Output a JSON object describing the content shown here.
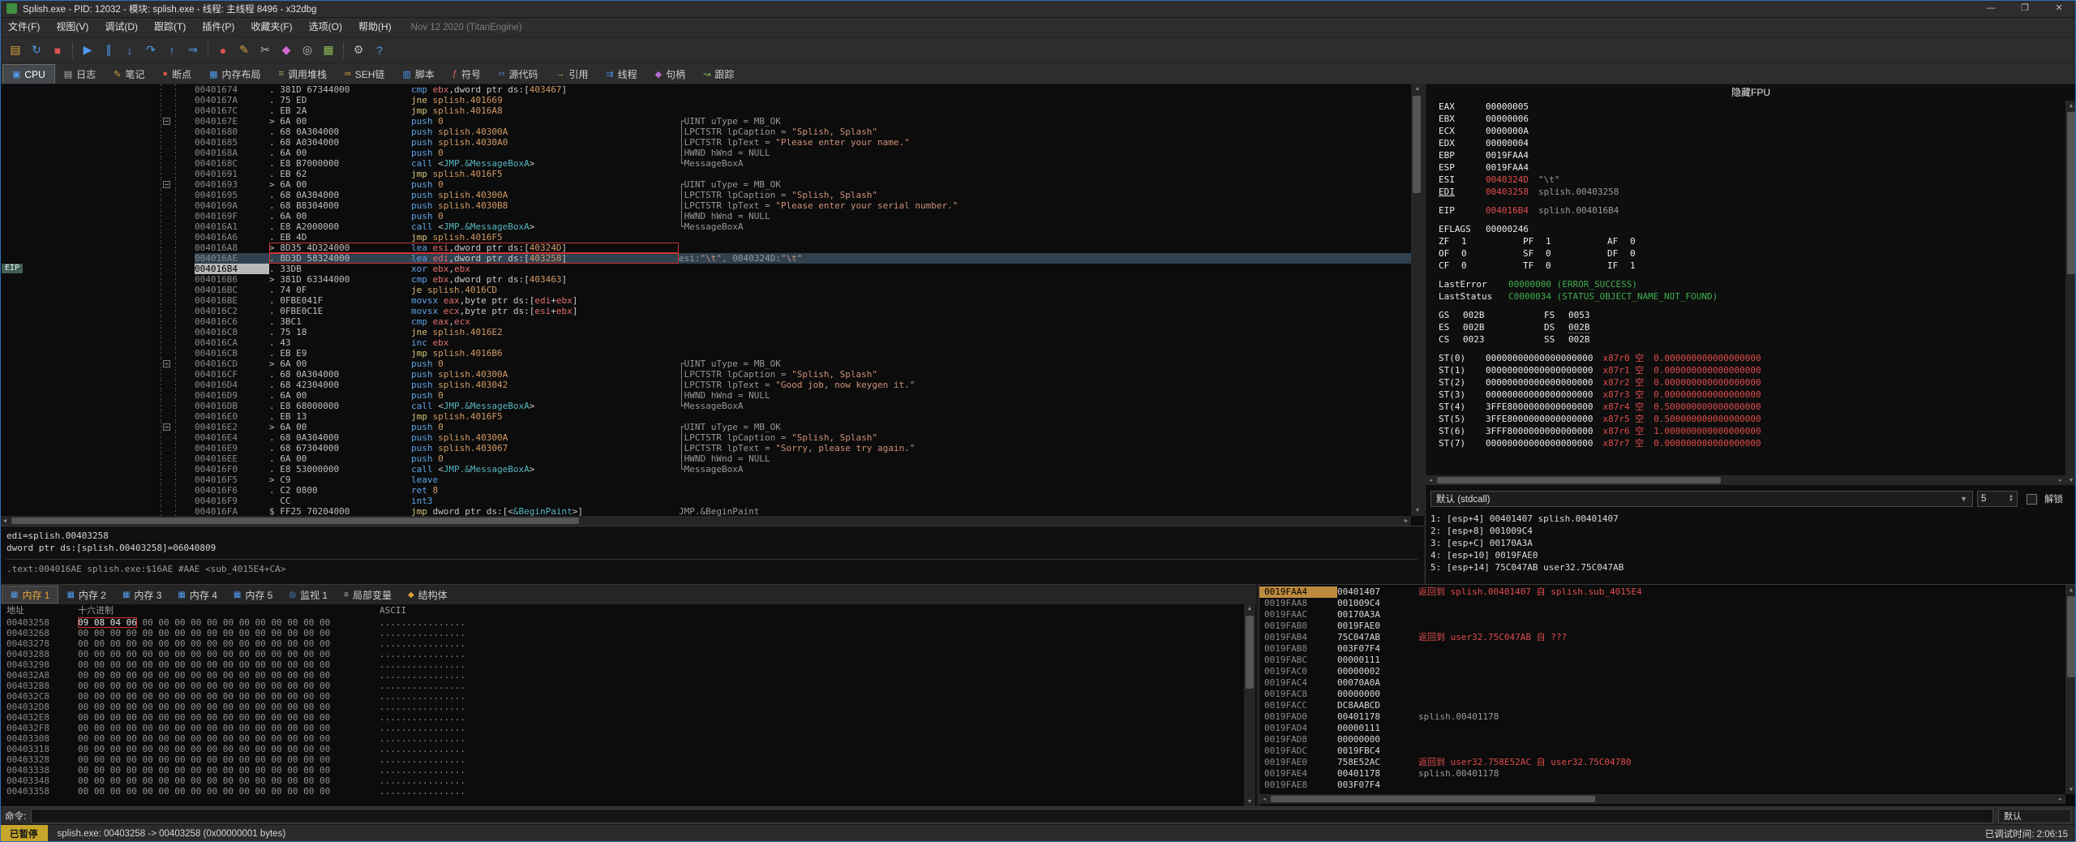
{
  "window": {
    "title": "Splish.exe - PID: 12032 - 模块: splish.exe - 线程: 主线程 8496 - x32dbg",
    "controls": {
      "minimize": "—",
      "maximize": "❐",
      "close": "✕"
    }
  },
  "menu": {
    "items": [
      "文件(F)",
      "视图(V)",
      "调试(D)",
      "跟踪(T)",
      "插件(P)",
      "收藏夹(F)",
      "选项(O)",
      "帮助(H)"
    ],
    "build_info": "Nov 12 2020 (TitanEngine)"
  },
  "toolbar": {
    "icons": [
      {
        "name": "open-file-icon",
        "glyph": "▤",
        "color": "#d9a33c"
      },
      {
        "name": "restart-icon",
        "glyph": "↻",
        "color": "#4f9cf0"
      },
      {
        "name": "stop-icon",
        "glyph": "■",
        "color": "#d9534f"
      },
      {
        "sep": true
      },
      {
        "name": "run-icon",
        "glyph": "▶",
        "color": "#4f9cf0"
      },
      {
        "name": "pause-icon",
        "glyph": "∥",
        "color": "#4f9cf0"
      },
      {
        "name": "step-into-icon",
        "glyph": "↓",
        "color": "#4f9cf0"
      },
      {
        "name": "step-over-icon",
        "glyph": "↷",
        "color": "#4f9cf0"
      },
      {
        "name": "step-out-icon",
        "glyph": "↑",
        "color": "#4f9cf0"
      },
      {
        "name": "run-to-cursor-icon",
        "glyph": "⇒",
        "color": "#4f9cf0"
      },
      {
        "sep": true
      },
      {
        "name": "breakpoint-icon",
        "glyph": "●",
        "color": "#d9534f"
      },
      {
        "name": "patch-icon",
        "glyph": "✎",
        "color": "#d9a33c"
      },
      {
        "name": "scissors-icon",
        "glyph": "✂",
        "color": "#b8b8b8"
      },
      {
        "name": "favourites-icon",
        "glyph": "◆",
        "color": "#d06ad0"
      },
      {
        "name": "search-icon",
        "glyph": "◎",
        "color": "#b8b8b8"
      },
      {
        "name": "calculator-icon",
        "glyph": "▦",
        "color": "#8fbc5a"
      },
      {
        "sep": true
      },
      {
        "name": "settings-icon",
        "glyph": "⚙",
        "color": "#b8b8b8"
      },
      {
        "name": "help-icon",
        "glyph": "?",
        "color": "#4f9cf0"
      }
    ]
  },
  "main_tabs": [
    {
      "id": "cpu",
      "label": "CPU",
      "icon": "cpu-icon",
      "glyph": "▣",
      "color": "#4f9cf0",
      "active": true
    },
    {
      "id": "log",
      "label": "日志",
      "icon": "log-icon",
      "glyph": "▤",
      "color": "#b8b8b8"
    },
    {
      "id": "notes",
      "label": "笔记",
      "icon": "notes-icon",
      "glyph": "✎",
      "color": "#d9a33c"
    },
    {
      "id": "breakpoints",
      "label": "断点",
      "icon": "breakpoint-icon",
      "glyph": "●",
      "color": "#d9534f"
    },
    {
      "id": "memory-map",
      "label": "内存布局",
      "icon": "memory-map-icon",
      "glyph": "▦",
      "color": "#4f9cf0"
    },
    {
      "id": "call-stack",
      "label": "调用堆栈",
      "icon": "call-stack-icon",
      "glyph": "≡",
      "color": "#8fbc5a"
    },
    {
      "id": "seh",
      "label": "SEH链",
      "icon": "seh-chain-icon",
      "glyph": "∞",
      "color": "#d9a33c"
    },
    {
      "id": "script",
      "label": "脚本",
      "icon": "script-icon",
      "glyph": "▥",
      "color": "#4f9cf0"
    },
    {
      "id": "symbols",
      "label": "符号",
      "icon": "symbols-icon",
      "glyph": "ƒ",
      "color": "#e06c6c"
    },
    {
      "id": "source",
      "label": "源代码",
      "icon": "source-code-icon",
      "glyph": "‹›",
      "color": "#4f9cf0"
    },
    {
      "id": "references",
      "label": "引用",
      "icon": "references-icon",
      "glyph": "→",
      "color": "#d9a33c"
    },
    {
      "id": "threads",
      "label": "线程",
      "icon": "threads-icon",
      "glyph": "⇉",
      "color": "#4f9cf0"
    },
    {
      "id": "handles",
      "label": "句柄",
      "icon": "handles-icon",
      "glyph": "◆",
      "color": "#b06ad0"
    },
    {
      "id": "trace",
      "label": "跟踪",
      "icon": "trace-icon",
      "glyph": "↝",
      "color": "#8fbc5a"
    }
  ],
  "disasm": {
    "eip_badge": "EIP",
    "rows": [
      {
        "a": "00401674",
        "b": ". 381D 67344000",
        "i": "cmp ebx,dword ptr ds:[403467]",
        "c": ""
      },
      {
        "a": "0040167A",
        "b": ". 75 ED",
        "i": "jne splish.401669",
        "c": ""
      },
      {
        "a": "0040167C",
        "b": ". EB 2A",
        "i": "jmp splish.4016A8",
        "c": ""
      },
      {
        "a": "0040167E",
        "b": "> 6A 00",
        "i": "push 0",
        "c": "┌UINT uType = MB_OK",
        "g": "box"
      },
      {
        "a": "00401680",
        "b": ". 68 0A304000",
        "i": "push splish.40300A",
        "c": "│LPCTSTR lpCaption = \"Splish, Splash\""
      },
      {
        "a": "00401685",
        "b": ". 68 A0304000",
        "i": "push splish.4030A0",
        "c": "│LPCTSTR lpText = \"Please enter your name.\""
      },
      {
        "a": "0040168A",
        "b": ". 6A 00",
        "i": "push 0",
        "c": "│HWND hWnd = NULL"
      },
      {
        "a": "0040168C",
        "b": ". E8 B7000000",
        "i": "call <JMP.&MessageBoxA>",
        "c": "└MessageBoxA"
      },
      {
        "a": "00401691",
        "b": ". EB 62",
        "i": "jmp splish.4016F5",
        "c": ""
      },
      {
        "a": "00401693",
        "b": "> 6A 00",
        "i": "push 0",
        "c": "┌UINT uType = MB_OK",
        "g": "box"
      },
      {
        "a": "00401695",
        "b": ". 68 0A304000",
        "i": "push splish.40300A",
        "c": "│LPCTSTR lpCaption = \"Splish, Splash\""
      },
      {
        "a": "0040169A",
        "b": ". 68 B8304000",
        "i": "push splish.4030B8",
        "c": "│LPCTSTR lpText = \"Please enter your serial number.\""
      },
      {
        "a": "0040169F",
        "b": ". 6A 00",
        "i": "push 0",
        "c": "│HWND hWnd = NULL"
      },
      {
        "a": "004016A1",
        "b": ". E8 A2000000",
        "i": "call <JMP.&MessageBoxA>",
        "c": "└MessageBoxA"
      },
      {
        "a": "004016A6",
        "b": ". EB 4D",
        "i": "jmp splish.4016F5",
        "c": ""
      },
      {
        "a": "004016A8",
        "b": "> 8D35 4D324000",
        "i": "lea esi,dword ptr ds:[40324D]",
        "c": "",
        "f": "bp"
      },
      {
        "a": "004016AE",
        "b": ". 8D3D 58324000",
        "i": "lea edi,dword ptr ds:[403258]",
        "c": "esi:\"\\t\", 0040324D:\"\\t\"",
        "f": "sel bp"
      },
      {
        "a": "004016B4",
        "b": ". 33DB",
        "i": "xor ebx,ebx",
        "c": "",
        "f": "eip",
        "g": "eip"
      },
      {
        "a": "004016B6",
        "b": "> 381D 63344000",
        "i": "cmp ebx,dword ptr ds:[403463]",
        "c": ""
      },
      {
        "a": "004016BC",
        "b": ". 74 0F",
        "i": "je splish.4016CD",
        "c": ""
      },
      {
        "a": "004016BE",
        "b": ". 0FBE041F",
        "i": "movsx eax,byte ptr ds:[edi+ebx]",
        "c": ""
      },
      {
        "a": "004016C2",
        "b": ". 0FBE0C1E",
        "i": "movsx ecx,byte ptr ds:[esi+ebx]",
        "c": ""
      },
      {
        "a": "004016C6",
        "b": ". 3BC1",
        "i": "cmp eax,ecx",
        "c": ""
      },
      {
        "a": "004016C8",
        "b": ". 75 18",
        "i": "jne splish.4016E2",
        "c": ""
      },
      {
        "a": "004016CA",
        "b": ". 43",
        "i": "inc ebx",
        "c": ""
      },
      {
        "a": "004016CB",
        "b": ". EB E9",
        "i": "jmp splish.4016B6",
        "c": ""
      },
      {
        "a": "004016CD",
        "b": "> 6A 00",
        "i": "push 0",
        "c": "┌UINT uType = MB_OK",
        "g": "box"
      },
      {
        "a": "004016CF",
        "b": ". 68 0A304000",
        "i": "push splish.40300A",
        "c": "│LPCTSTR lpCaption = \"Splish, Splash\""
      },
      {
        "a": "004016D4",
        "b": ". 68 42304000",
        "i": "push splish.403042",
        "c": "│LPCTSTR lpText = \"Good job, now keygen it.\""
      },
      {
        "a": "004016D9",
        "b": ". 6A 00",
        "i": "push 0",
        "c": "│HWND hWnd = NULL"
      },
      {
        "a": "004016DB",
        "b": ". E8 68000000",
        "i": "call <JMP.&MessageBoxA>",
        "c": "└MessageBoxA"
      },
      {
        "a": "004016E0",
        "b": ". EB 13",
        "i": "jmp splish.4016F5",
        "c": ""
      },
      {
        "a": "004016E2",
        "b": "> 6A 00",
        "i": "push 0",
        "c": "┌UINT uType = MB_OK",
        "g": "box"
      },
      {
        "a": "004016E4",
        "b": ". 68 0A304000",
        "i": "push splish.40300A",
        "c": "│LPCTSTR lpCaption = \"Splish, Splash\""
      },
      {
        "a": "004016E9",
        "b": ". 68 67304000",
        "i": "push splish.403067",
        "c": "│LPCTSTR lpText = \"Sorry, please try again.\""
      },
      {
        "a": "004016EE",
        "b": ". 6A 00",
        "i": "push 0",
        "c": "│HWND hWnd = NULL"
      },
      {
        "a": "004016F0",
        "b": ". E8 53000000",
        "i": "call <JMP.&MessageBoxA>",
        "c": "└MessageBoxA"
      },
      {
        "a": "004016F5",
        "b": "> C9",
        "i": "leave",
        "c": ""
      },
      {
        "a": "004016F6",
        "b": ". C2 0800",
        "i": "ret 8",
        "c": ""
      },
      {
        "a": "004016F9",
        "b": "  CC",
        "i": "int3",
        "c": ""
      },
      {
        "a": "004016FA",
        "b": "$ FF25 70204000",
        "i": "jmp dword ptr ds:[<&BeginPaint>]",
        "c": "JMP.&BeginPaint"
      }
    ]
  },
  "info_pane": {
    "line1": "edi=splish.00403258",
    "line2": "dword ptr ds:[splish.00403258]=06040809",
    "line3": ".text:004016AE splish.exe:$16AE #AAE <sub_4015E4+CA>"
  },
  "registers": {
    "hide_fpu_label": "隐藏FPU",
    "gpr": [
      {
        "n": "EAX",
        "v": "00000005"
      },
      {
        "n": "EBX",
        "v": "00000006"
      },
      {
        "n": "ECX",
        "v": "0000000A"
      },
      {
        "n": "EDX",
        "v": "00000004"
      },
      {
        "n": "EBP",
        "v": "0019FAA4"
      },
      {
        "n": "ESP",
        "v": "0019FAA4"
      },
      {
        "n": "ESI",
        "v": "0040324D",
        "chg": true,
        "c": "\"\\t\""
      },
      {
        "n": "EDI",
        "v": "00403258",
        "chg": true,
        "c": "splish.00403258",
        "u": true
      }
    ],
    "eip": {
      "n": "EIP",
      "v": "004016B4",
      "chg": true,
      "c": "splish.004016B4"
    },
    "eflags": {
      "n": "EFLAGS",
      "v": "00000246"
    },
    "flag_rows": [
      [
        {
          "n": "ZF",
          "v": "1"
        },
        {
          "n": "PF",
          "v": "1"
        },
        {
          "n": "AF",
          "v": "0"
        }
      ],
      [
        {
          "n": "OF",
          "v": "0"
        },
        {
          "n": "SF",
          "v": "0"
        },
        {
          "n": "DF",
          "v": "0"
        }
      ],
      [
        {
          "n": "CF",
          "v": "0"
        },
        {
          "n": "TF",
          "v": "0"
        },
        {
          "n": "IF",
          "v": "1"
        }
      ]
    ],
    "last_error": {
      "n": "LastError",
      "v": "00000000 (ERROR_SUCCESS)"
    },
    "last_status": {
      "n": "LastStatus",
      "v": "C0000034 (STATUS_OBJECT_NAME_NOT_FOUND)"
    },
    "seg_rows": [
      [
        {
          "n": "GS",
          "v": "002B"
        },
        {
          "n": "FS",
          "v": "0053"
        }
      ],
      [
        {
          "n": "ES",
          "v": "002B"
        },
        {
          "n": "DS",
          "v": "002B",
          "u": true
        }
      ],
      [
        {
          "n": "CS",
          "v": "0023"
        },
        {
          "n": "SS",
          "v": "002B"
        }
      ]
    ],
    "fpu": [
      {
        "n": "ST(0)",
        "r": "00000000000000000000",
        "t": "x87r0 空",
        "v": "0.000000000000000000"
      },
      {
        "n": "ST(1)",
        "r": "00000000000000000000",
        "t": "x87r1 空",
        "v": "0.000000000000000000"
      },
      {
        "n": "ST(2)",
        "r": "00000000000000000000",
        "t": "x87r2 空",
        "v": "0.000000000000000000"
      },
      {
        "n": "ST(3)",
        "r": "00000000000000000000",
        "t": "x87r3 空",
        "v": "0.000000000000000000"
      },
      {
        "n": "ST(4)",
        "r": "3FFE8000000000000000",
        "t": "x87r4 空",
        "v": "0.500000000000000000"
      },
      {
        "n": "ST(5)",
        "r": "3FFE8000000000000000",
        "t": "x87r5 空",
        "v": "0.500000000000000000"
      },
      {
        "n": "ST(6)",
        "r": "3FFF8000000000000000",
        "t": "x87r6 空",
        "v": "1.000000000000000000"
      },
      {
        "n": "ST(7)",
        "r": "00000000000000000000",
        "t": "x87r7 空",
        "v": "0.000000000000000000"
      }
    ]
  },
  "args_view": {
    "convention": "默认 (stdcall)",
    "count": "5",
    "unlock_label": "解锁",
    "args": [
      "1: [esp+4] 00401407 splish.00401407",
      "2: [esp+8] 001009C4",
      "3: [esp+C] 00170A3A",
      "4: [esp+10] 0019FAE0",
      "5: [esp+14] 75C047AB user32.75C047AB"
    ]
  },
  "dump": {
    "tabs": [
      {
        "id": "dump1",
        "label": "内存 1",
        "glyph": "▦",
        "color": "#4f9cf0",
        "active": true
      },
      {
        "id": "dump2",
        "label": "内存 2",
        "glyph": "▦",
        "color": "#4f9cf0"
      },
      {
        "id": "dump3",
        "label": "内存 3",
        "glyph": "▦",
        "color": "#4f9cf0"
      },
      {
        "id": "dump4",
        "label": "内存 4",
        "glyph": "▦",
        "color": "#4f9cf0"
      },
      {
        "id": "dump5",
        "label": "内存 5",
        "glyph": "▦",
        "color": "#4f9cf0"
      },
      {
        "id": "watch1",
        "label": "监视 1",
        "glyph": "◎",
        "color": "#4f9cf0"
      },
      {
        "id": "locals",
        "label": "局部变量",
        "glyph": "≡",
        "color": "#b8b8b8"
      },
      {
        "id": "struct",
        "label": "结构体",
        "glyph": "◆",
        "color": "#d9a33c"
      }
    ],
    "headers": {
      "addr": "地址",
      "hex": "十六进制",
      "ascii": "ASCII"
    },
    "rows": [
      {
        "a": "00403258",
        "h": "09 08 04 06 00 00 00 00 00 00 00 00 00 00 00 00",
        "s": "................",
        "m": 4
      },
      {
        "a": "00403268",
        "h": "00 00 00 00 00 00 00 00 00 00 00 00 00 00 00 00",
        "s": "................"
      },
      {
        "a": "00403278",
        "h": "00 00 00 00 00 00 00 00 00 00 00 00 00 00 00 00",
        "s": "................"
      },
      {
        "a": "00403288",
        "h": "00 00 00 00 00 00 00 00 00 00 00 00 00 00 00 00",
        "s": "................"
      },
      {
        "a": "00403298",
        "h": "00 00 00 00 00 00 00 00 00 00 00 00 00 00 00 00",
        "s": "................"
      },
      {
        "a": "004032A8",
        "h": "00 00 00 00 00 00 00 00 00 00 00 00 00 00 00 00",
        "s": "................"
      },
      {
        "a": "004032B8",
        "h": "00 00 00 00 00 00 00 00 00 00 00 00 00 00 00 00",
        "s": "................"
      },
      {
        "a": "004032C8",
        "h": "00 00 00 00 00 00 00 00 00 00 00 00 00 00 00 00",
        "s": "................"
      },
      {
        "a": "004032D8",
        "h": "00 00 00 00 00 00 00 00 00 00 00 00 00 00 00 00",
        "s": "................"
      },
      {
        "a": "004032E8",
        "h": "00 00 00 00 00 00 00 00 00 00 00 00 00 00 00 00",
        "s": "................"
      },
      {
        "a": "004032F8",
        "h": "00 00 00 00 00 00 00 00 00 00 00 00 00 00 00 00",
        "s": "................"
      },
      {
        "a": "00403308",
        "h": "00 00 00 00 00 00 00 00 00 00 00 00 00 00 00 00",
        "s": "................"
      },
      {
        "a": "00403318",
        "h": "00 00 00 00 00 00 00 00 00 00 00 00 00 00 00 00",
        "s": "................"
      },
      {
        "a": "00403328",
        "h": "00 00 00 00 00 00 00 00 00 00 00 00 00 00 00 00",
        "s": "................"
      },
      {
        "a": "00403338",
        "h": "00 00 00 00 00 00 00 00 00 00 00 00 00 00 00 00",
        "s": "................"
      },
      {
        "a": "00403348",
        "h": "00 00 00 00 00 00 00 00 00 00 00 00 00 00 00 00",
        "s": "................"
      },
      {
        "a": "00403358",
        "h": "00 00 00 00 00 00 00 00 00 00 00 00 00 00 00 00",
        "s": "................"
      }
    ]
  },
  "stack": {
    "rows": [
      {
        "a": "0019FAA4",
        "v": "00401407",
        "c": "返回到 splish.00401407 自 splish.sub_4015E4",
        "t": "ret",
        "sel": true
      },
      {
        "a": "0019FAA8",
        "v": "001009C4"
      },
      {
        "a": "0019FAAC",
        "v": "00170A3A"
      },
      {
        "a": "0019FAB0",
        "v": "0019FAE0"
      },
      {
        "a": "0019FAB4",
        "v": "75C047AB",
        "c": "返回到 user32.75C047AB 自 ???",
        "t": "ret"
      },
      {
        "a": "0019FAB8",
        "v": "003F07F4"
      },
      {
        "a": "0019FABC",
        "v": "00000111"
      },
      {
        "a": "0019FAC0",
        "v": "00000002"
      },
      {
        "a": "0019FAC4",
        "v": "00070A0A"
      },
      {
        "a": "0019FAC8",
        "v": "00000000"
      },
      {
        "a": "0019FACC",
        "v": "DC8AABCD"
      },
      {
        "a": "0019FAD0",
        "v": "00401178",
        "c": "splish.00401178",
        "t": "lbl"
      },
      {
        "a": "0019FAD4",
        "v": "00000111"
      },
      {
        "a": "0019FAD8",
        "v": "00000000"
      },
      {
        "a": "0019FADC",
        "v": "0019FBC4"
      },
      {
        "a": "0019FAE0",
        "v": "758E52AC",
        "c": "返回到 user32.758E52AC 自 user32.75C04780",
        "t": "ret"
      },
      {
        "a": "0019FAE4",
        "v": "00401178",
        "c": "splish.00401178",
        "t": "lbl"
      },
      {
        "a": "0019FAE8",
        "v": "003F07F4"
      }
    ]
  },
  "command_bar": {
    "label": "命令:",
    "value": "",
    "placeholder": "",
    "profile": "默认"
  },
  "status_bar": {
    "state": "已暂停",
    "message": "splish.exe: 00403258 -> 00403258 (0x00000001 bytes)",
    "time": "已调试时间: 2:06:15"
  },
  "colors": {
    "accent_red": "#e04b4b",
    "accent_orange": "#d19a66",
    "accent_blue": "#5ea2ea",
    "accent_yellow": "#d6c47a",
    "success_green": "#3fae4f",
    "paused_badge": "#c7a52a",
    "selection": "#30414f",
    "cip_bg": "#b9b9b9",
    "breakpoint_outline": "#cc3333",
    "stack_selected_bg": "#bd8b3e"
  }
}
